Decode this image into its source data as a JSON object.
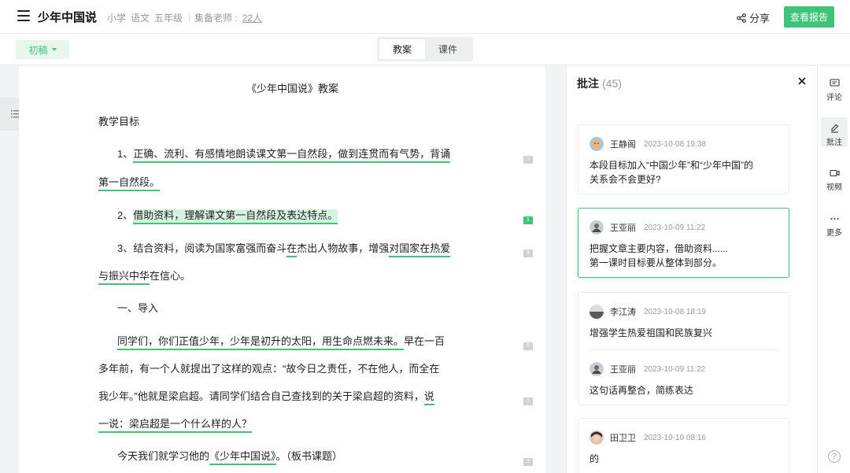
{
  "header": {
    "title": "少年中国说",
    "meta": [
      "小学",
      "语文",
      "五年级"
    ],
    "teacher_label": "集备老师 :",
    "teacher_count": "22人",
    "share_label": "分享",
    "report_label": "查看报告"
  },
  "toolbar": {
    "draft_label": "初稿",
    "tabs": [
      "教案",
      "课件"
    ],
    "active_tab": "教案"
  },
  "document": {
    "title": "《少年中国说》教案",
    "section_goals": "教学目标",
    "goal1": {
      "prefix": "1、",
      "underlined": "正确、流利、有感情地朗读课文第一自然段，做到连贯而有气势，背诵",
      "line2": "第一自然段。"
    },
    "goal2": {
      "prefix": "2、",
      "highlighted": "借助资料，理解课文第一自然段及表达特点。"
    },
    "goal3": {
      "part1": "3、结合资料，阅读为国家富强而奋斗",
      "part2": "在",
      "part3": "杰出人物故事，增强",
      "part4": "对",
      "part5": "国家在热爱",
      "line2_ul": "与振兴中华",
      "line2_rest": "在信心。"
    },
    "section_intro": "一、导入",
    "para1": {
      "ul1": "同学们，你们正值少年，少年是初升的太阳，用生命点燃未来。",
      "rest1": "早在一百",
      "line2": "多年前，有一个人就提出了这样的观点：“故今日之责任，不在他人，而全在",
      "line3_a": "我少年。”他就是梁启超。请同学们结合自己查找到的关于梁启超的资料，",
      "line3_ul": "说",
      "line4": "一说：梁启超是一个什么样的人？"
    },
    "para2": {
      "a": "今天我们就学习他的",
      "ul": "《少年中国说》",
      "b": "。（板书课题）"
    },
    "markers": [
      "1",
      "1",
      "3",
      "5",
      "1",
      "3"
    ]
  },
  "panel": {
    "title": "批注",
    "count": "(45)",
    "comments": [
      {
        "name": "王静阁",
        "time": "2023-10-08 19:38",
        "text": "本段目标加入“中国少年”和“少年中国”的\n关系会不会更好?"
      },
      {
        "name": "王亚丽",
        "time": "2023-10-09 11:22",
        "text": "把握文章主要内容，借助资料......\n第一课时目标要从整体到部分。"
      },
      {
        "name": "李江涛",
        "time": "2023-10-08 18:19",
        "text": "增强学生热爱祖国和民族复兴"
      },
      {
        "name": "王亚丽",
        "time": "2023-10-09 11:22",
        "text": "这句话再整合，简练表达"
      },
      {
        "name": "田卫卫",
        "time": "2023-10-10 08:16",
        "text": "的"
      }
    ]
  },
  "rail": {
    "items": [
      "评论",
      "批注",
      "视频",
      "更多"
    ],
    "help": "?"
  },
  "colors": {
    "accent": "#3ec479",
    "accent_light": "#e8f6ee",
    "highlight": "#d6f2e0"
  }
}
